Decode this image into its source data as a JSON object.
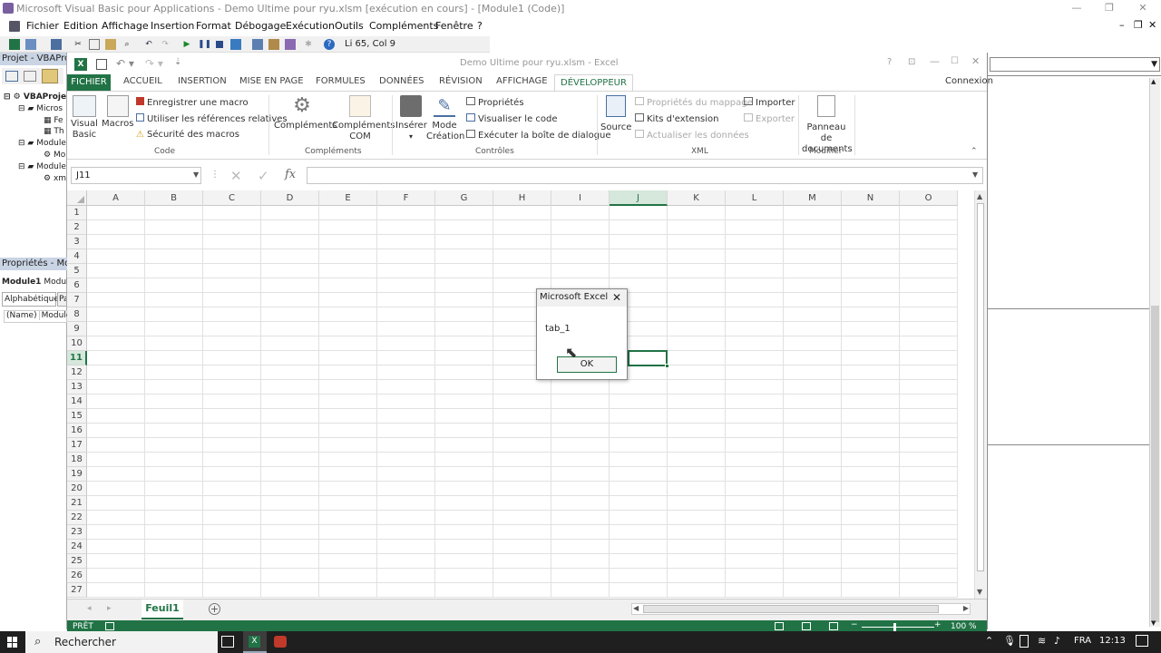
{
  "vba": {
    "title": "Microsoft Visual Basic pour Applications - Demo Ultime pour ryu.xlsm [exécution en cours] - [Module1 (Code)]",
    "menu": [
      "Fichier",
      "Edition",
      "Affichage",
      "Insertion",
      "Format",
      "Débogage",
      "Exécution",
      "Outils",
      "Compléments",
      "Fenêtre",
      "?"
    ],
    "position": "Li 65, Col 9",
    "project_title": "Projet - VBAProje",
    "tree": [
      "VBAProje",
      "Micros",
      "Fe",
      "Th",
      "Module",
      "Mo",
      "Module",
      "xm"
    ],
    "props_title": "Propriétés - Modu",
    "props_object": "Module1",
    "props_object_type": "Module",
    "props_tab1": "Alphabétique",
    "props_tab2": "Pa",
    "props_name_key": "(Name)",
    "props_name_val": "Module1"
  },
  "excel": {
    "title": "Demo Ultime pour ryu.xlsm - Excel",
    "account": "Connexion",
    "tabs": [
      "FICHIER",
      "ACCUEIL",
      "INSERTION",
      "MISE EN PAGE",
      "FORMULES",
      "DONNÉES",
      "RÉVISION",
      "AFFICHAGE",
      "DÉVELOPPEUR"
    ],
    "ribbon": {
      "visual_basic_1": "Visual",
      "visual_basic_2": "Basic",
      "macros": "Macros",
      "record_macro": "Enregistrer une macro",
      "relative_refs": "Utiliser les références relatives",
      "macro_security": "Sécurité des macros",
      "group_code": "Code",
      "addins": "Compléments",
      "com_addins_1": "Compléments",
      "com_addins_2": "COM",
      "group_addins": "Compléments",
      "insert": "Insérer",
      "design_mode_1": "Mode",
      "design_mode_2": "Création",
      "properties": "Propriétés",
      "view_code": "Visualiser le code",
      "run_dialog": "Exécuter la boîte de dialogue",
      "group_controls": "Contrôles",
      "source": "Source",
      "map_props": "Propriétés du mappage",
      "expansion_packs": "Kits d'extension",
      "refresh_data": "Actualiser les données",
      "import": "Importer",
      "export": "Exporter",
      "group_xml": "XML",
      "doc_panel_1": "Panneau de",
      "doc_panel_2": "documents",
      "group_modify": "Modifier"
    },
    "name_box": "J11",
    "fx": "fx",
    "columns": [
      "A",
      "B",
      "C",
      "D",
      "E",
      "F",
      "G",
      "H",
      "I",
      "J",
      "K",
      "L",
      "M",
      "N",
      "O"
    ],
    "rows": [
      "1",
      "2",
      "3",
      "4",
      "5",
      "6",
      "7",
      "8",
      "9",
      "10",
      "11",
      "12",
      "13",
      "14",
      "15",
      "16",
      "17",
      "18",
      "19",
      "20",
      "21",
      "22",
      "23",
      "24",
      "25",
      "26",
      "27"
    ],
    "selected_col": "J",
    "selected_row": "11",
    "sheet_tab": "Feuil1",
    "status_ready": "PRÊT",
    "zoom": "100 %"
  },
  "dialog": {
    "title": "Microsoft Excel",
    "message": "tab_1",
    "ok": "OK"
  },
  "taskbar": {
    "search": "Rechercher",
    "lang": "FRA",
    "time": "12:13"
  },
  "colors": {
    "excel_green": "#217346",
    "taskbar": "#1f1f1f"
  }
}
